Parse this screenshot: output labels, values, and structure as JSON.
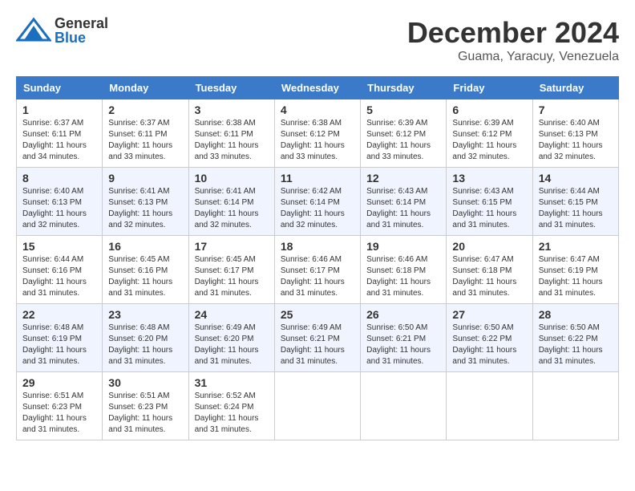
{
  "header": {
    "logo_general": "General",
    "logo_blue": "Blue",
    "month_title": "December 2024",
    "subtitle": "Guama, Yaracuy, Venezuela"
  },
  "days_of_week": [
    "Sunday",
    "Monday",
    "Tuesday",
    "Wednesday",
    "Thursday",
    "Friday",
    "Saturday"
  ],
  "weeks": [
    [
      {
        "day": "1",
        "sunrise": "6:37 AM",
        "sunset": "6:11 PM",
        "daylight": "11 hours and 34 minutes."
      },
      {
        "day": "2",
        "sunrise": "6:37 AM",
        "sunset": "6:11 PM",
        "daylight": "11 hours and 33 minutes."
      },
      {
        "day": "3",
        "sunrise": "6:38 AM",
        "sunset": "6:11 PM",
        "daylight": "11 hours and 33 minutes."
      },
      {
        "day": "4",
        "sunrise": "6:38 AM",
        "sunset": "6:12 PM",
        "daylight": "11 hours and 33 minutes."
      },
      {
        "day": "5",
        "sunrise": "6:39 AM",
        "sunset": "6:12 PM",
        "daylight": "11 hours and 33 minutes."
      },
      {
        "day": "6",
        "sunrise": "6:39 AM",
        "sunset": "6:12 PM",
        "daylight": "11 hours and 32 minutes."
      },
      {
        "day": "7",
        "sunrise": "6:40 AM",
        "sunset": "6:13 PM",
        "daylight": "11 hours and 32 minutes."
      }
    ],
    [
      {
        "day": "8",
        "sunrise": "6:40 AM",
        "sunset": "6:13 PM",
        "daylight": "11 hours and 32 minutes."
      },
      {
        "day": "9",
        "sunrise": "6:41 AM",
        "sunset": "6:13 PM",
        "daylight": "11 hours and 32 minutes."
      },
      {
        "day": "10",
        "sunrise": "6:41 AM",
        "sunset": "6:14 PM",
        "daylight": "11 hours and 32 minutes."
      },
      {
        "day": "11",
        "sunrise": "6:42 AM",
        "sunset": "6:14 PM",
        "daylight": "11 hours and 32 minutes."
      },
      {
        "day": "12",
        "sunrise": "6:43 AM",
        "sunset": "6:14 PM",
        "daylight": "11 hours and 31 minutes."
      },
      {
        "day": "13",
        "sunrise": "6:43 AM",
        "sunset": "6:15 PM",
        "daylight": "11 hours and 31 minutes."
      },
      {
        "day": "14",
        "sunrise": "6:44 AM",
        "sunset": "6:15 PM",
        "daylight": "11 hours and 31 minutes."
      }
    ],
    [
      {
        "day": "15",
        "sunrise": "6:44 AM",
        "sunset": "6:16 PM",
        "daylight": "11 hours and 31 minutes."
      },
      {
        "day": "16",
        "sunrise": "6:45 AM",
        "sunset": "6:16 PM",
        "daylight": "11 hours and 31 minutes."
      },
      {
        "day": "17",
        "sunrise": "6:45 AM",
        "sunset": "6:17 PM",
        "daylight": "11 hours and 31 minutes."
      },
      {
        "day": "18",
        "sunrise": "6:46 AM",
        "sunset": "6:17 PM",
        "daylight": "11 hours and 31 minutes."
      },
      {
        "day": "19",
        "sunrise": "6:46 AM",
        "sunset": "6:18 PM",
        "daylight": "11 hours and 31 minutes."
      },
      {
        "day": "20",
        "sunrise": "6:47 AM",
        "sunset": "6:18 PM",
        "daylight": "11 hours and 31 minutes."
      },
      {
        "day": "21",
        "sunrise": "6:47 AM",
        "sunset": "6:19 PM",
        "daylight": "11 hours and 31 minutes."
      }
    ],
    [
      {
        "day": "22",
        "sunrise": "6:48 AM",
        "sunset": "6:19 PM",
        "daylight": "11 hours and 31 minutes."
      },
      {
        "day": "23",
        "sunrise": "6:48 AM",
        "sunset": "6:20 PM",
        "daylight": "11 hours and 31 minutes."
      },
      {
        "day": "24",
        "sunrise": "6:49 AM",
        "sunset": "6:20 PM",
        "daylight": "11 hours and 31 minutes."
      },
      {
        "day": "25",
        "sunrise": "6:49 AM",
        "sunset": "6:21 PM",
        "daylight": "11 hours and 31 minutes."
      },
      {
        "day": "26",
        "sunrise": "6:50 AM",
        "sunset": "6:21 PM",
        "daylight": "11 hours and 31 minutes."
      },
      {
        "day": "27",
        "sunrise": "6:50 AM",
        "sunset": "6:22 PM",
        "daylight": "11 hours and 31 minutes."
      },
      {
        "day": "28",
        "sunrise": "6:50 AM",
        "sunset": "6:22 PM",
        "daylight": "11 hours and 31 minutes."
      }
    ],
    [
      {
        "day": "29",
        "sunrise": "6:51 AM",
        "sunset": "6:23 PM",
        "daylight": "11 hours and 31 minutes."
      },
      {
        "day": "30",
        "sunrise": "6:51 AM",
        "sunset": "6:23 PM",
        "daylight": "11 hours and 31 minutes."
      },
      {
        "day": "31",
        "sunrise": "6:52 AM",
        "sunset": "6:24 PM",
        "daylight": "11 hours and 31 minutes."
      },
      null,
      null,
      null,
      null
    ]
  ]
}
